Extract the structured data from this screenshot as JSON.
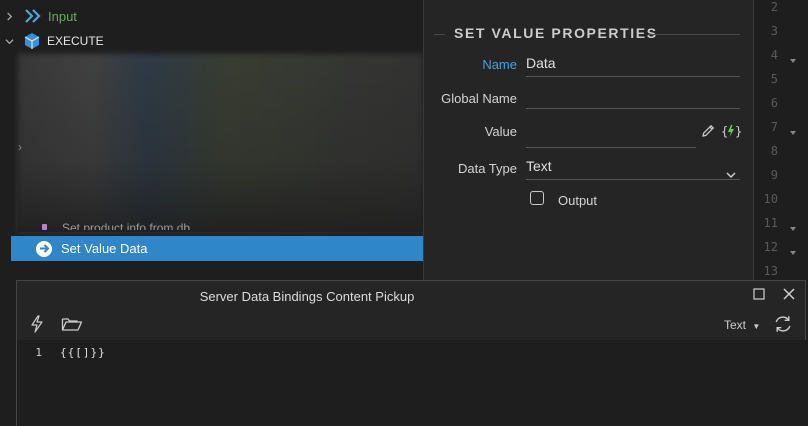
{
  "tree": {
    "input_label": "Input",
    "execute_label": "EXECUTE",
    "partial_label": "Set product info from db",
    "selected_label": "Set Value Data"
  },
  "properties": {
    "title": "SET VALUE PROPERTIES",
    "name_label": "Name",
    "name_value": "Data",
    "global_name_label": "Global Name",
    "global_name_value": "",
    "value_label": "Value",
    "value_value": "",
    "data_type_label": "Data Type",
    "data_type_value": "Text",
    "output_label": "Output",
    "output_checked": false
  },
  "gutter": {
    "lines": [
      "2",
      "3",
      "4",
      "5",
      "6",
      "7",
      "8",
      "9",
      "10",
      "11",
      "12",
      "13"
    ],
    "folded": [
      "4",
      "7",
      "11",
      "12"
    ]
  },
  "dialog": {
    "title": "Server Data Bindings Content Pickup",
    "mode_label": "Text",
    "code_line_number": "1",
    "code_text": "{{[]}}"
  },
  "colors": {
    "accent": "#2f86c9",
    "name_label": "#4a9fe0",
    "input_green": "#6aaa5e",
    "execute_blue": "#4fa3e0",
    "lightning_green": "#6ccf4a"
  }
}
